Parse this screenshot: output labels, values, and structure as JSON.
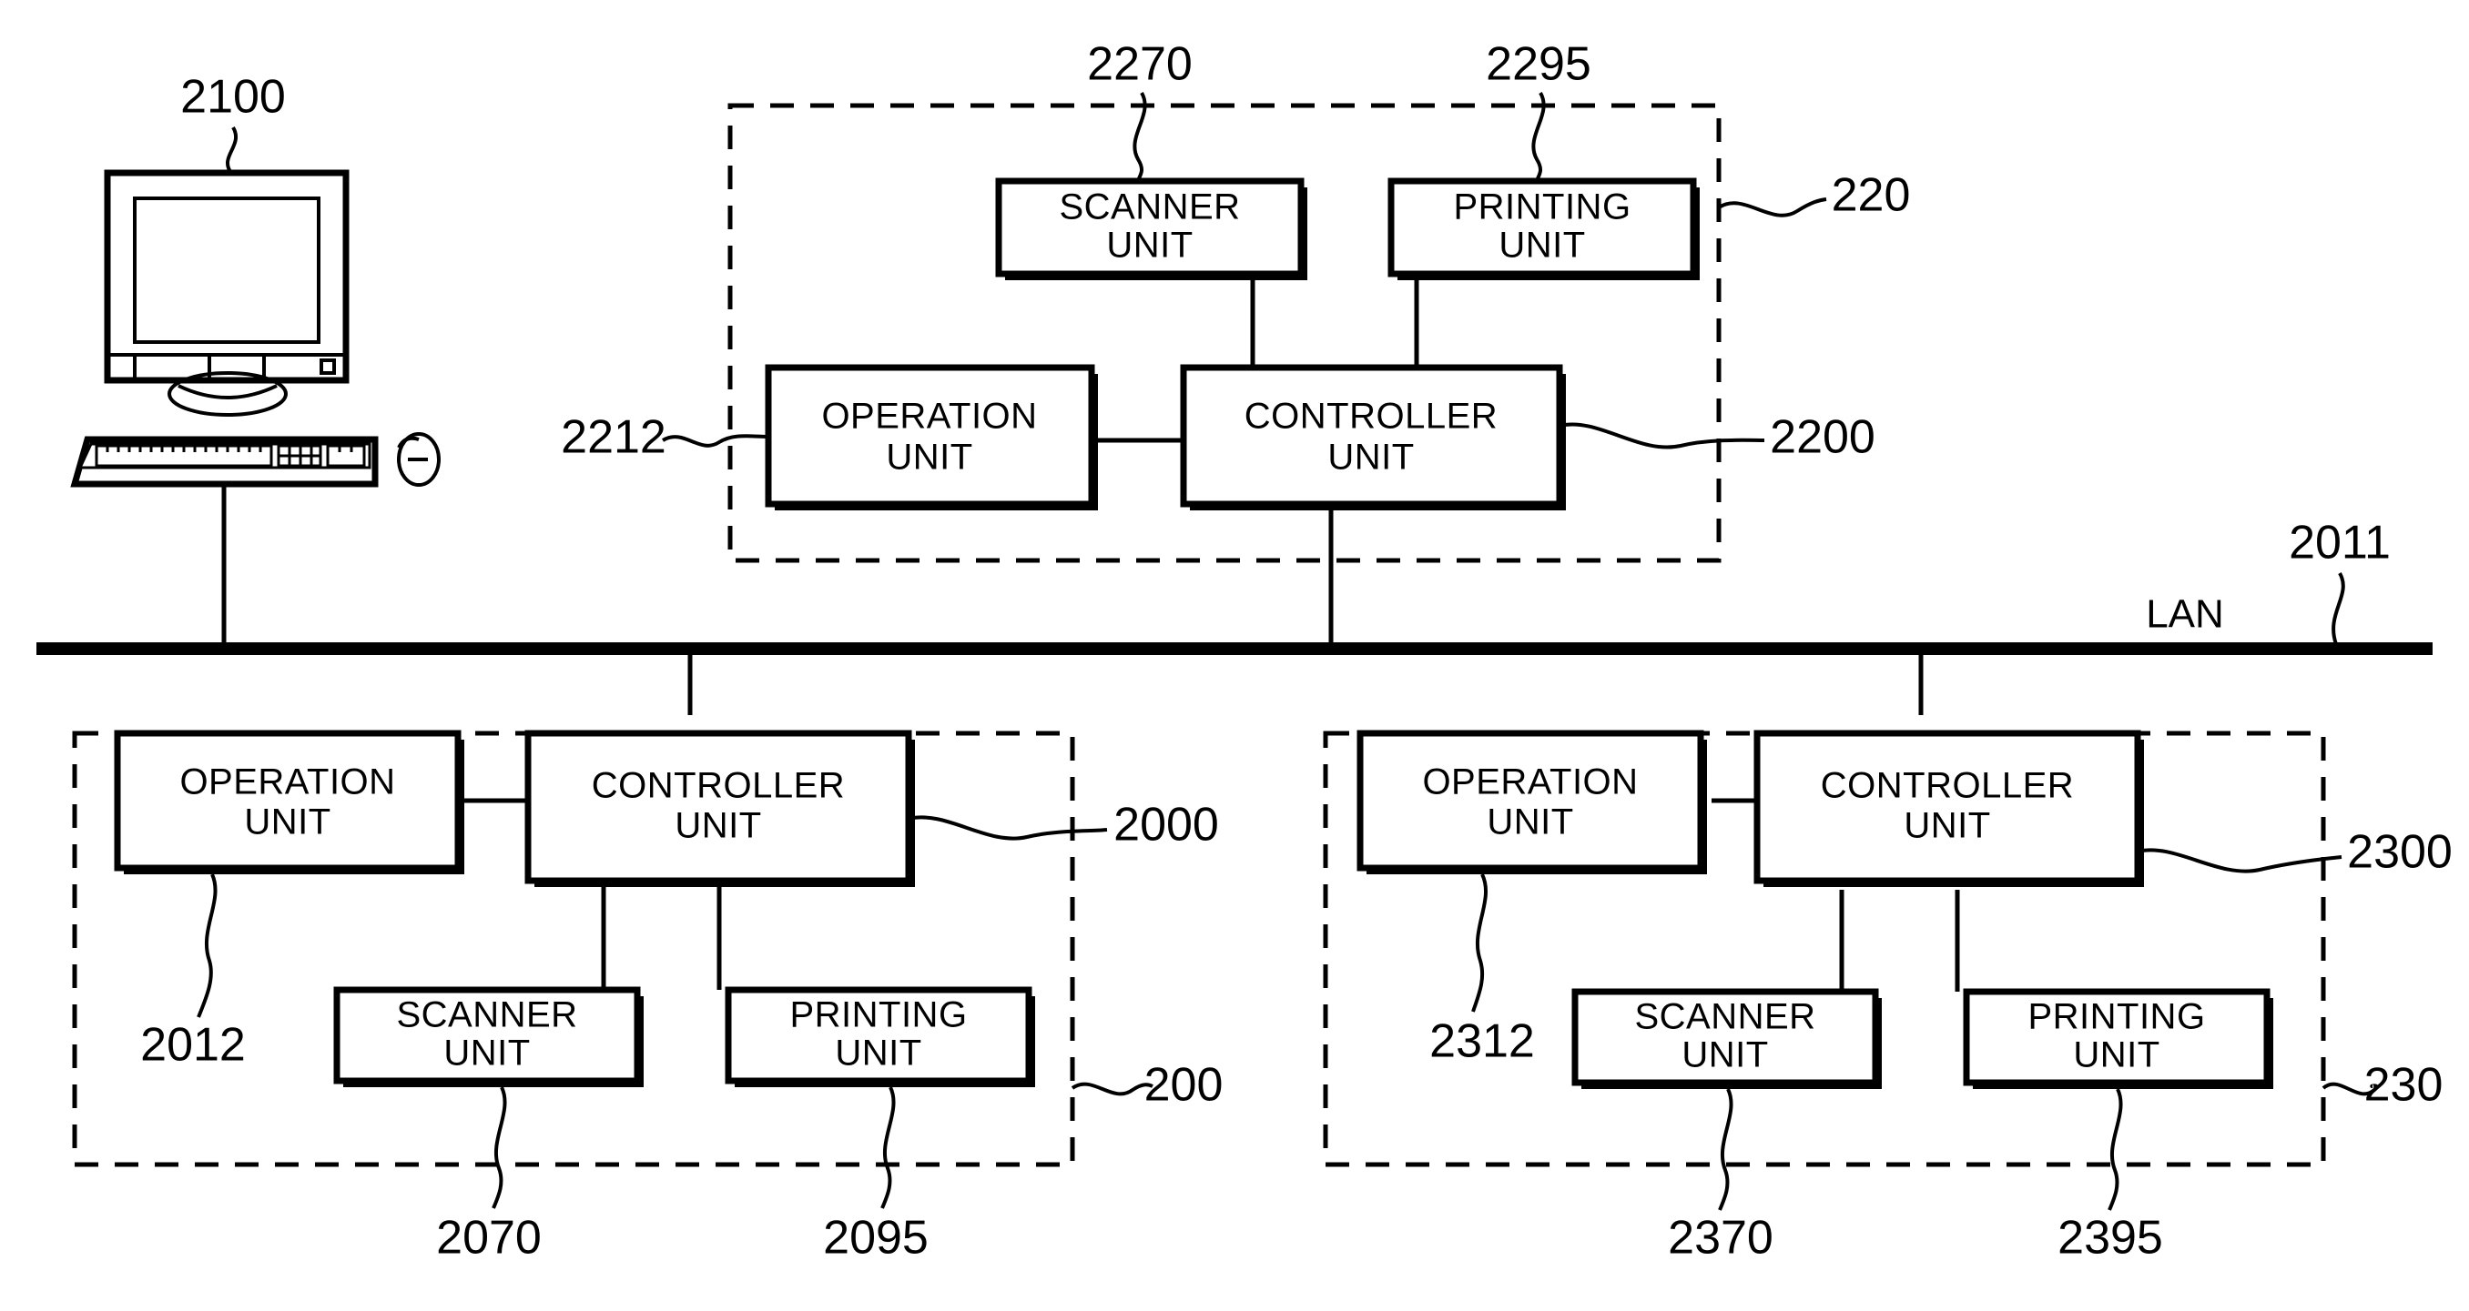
{
  "figure": {
    "type": "patent-block-diagram",
    "network_label": "LAN",
    "network_ref": "2011"
  },
  "workstation": {
    "name": "host-computer",
    "ref": "2100"
  },
  "devices": [
    {
      "id": "device-top",
      "boundary_ref": "220",
      "controller": {
        "label": "CONTROLLER\nUNIT",
        "line1": "CONTROLLER",
        "line2": "UNIT",
        "ref": "2200"
      },
      "operation": {
        "label": "OPERATION\nUNIT",
        "line1": "OPERATION",
        "line2": "UNIT",
        "ref": "2212"
      },
      "scanner": {
        "label": "SCANNER\nUNIT",
        "line1": "SCANNER",
        "line2": "UNIT",
        "ref": "2270"
      },
      "printing": {
        "label": "PRINTING\nUNIT",
        "line1": "PRINTING",
        "line2": "UNIT",
        "ref": "2295"
      }
    },
    {
      "id": "device-bottom-left",
      "boundary_ref": "200",
      "controller": {
        "line1": "CONTROLLER",
        "line2": "UNIT",
        "ref": "2000"
      },
      "operation": {
        "line1": "OPERATION",
        "line2": "UNIT",
        "ref": "2012"
      },
      "scanner": {
        "line1": "SCANNER",
        "line2": "UNIT",
        "ref": "2070"
      },
      "printing": {
        "line1": "PRINTING",
        "line2": "UNIT",
        "ref": "2095"
      }
    },
    {
      "id": "device-bottom-right",
      "boundary_ref": "230",
      "controller": {
        "line1": "CONTROLLER",
        "line2": "UNIT",
        "ref": "2300"
      },
      "operation": {
        "line1": "OPERATION",
        "line2": "UNIT",
        "ref": "2312"
      },
      "scanner": {
        "line1": "SCANNER",
        "line2": "UNIT",
        "ref": "2370"
      },
      "printing": {
        "line1": "PRINTING",
        "line2": "UNIT",
        "ref": "2395"
      }
    }
  ]
}
